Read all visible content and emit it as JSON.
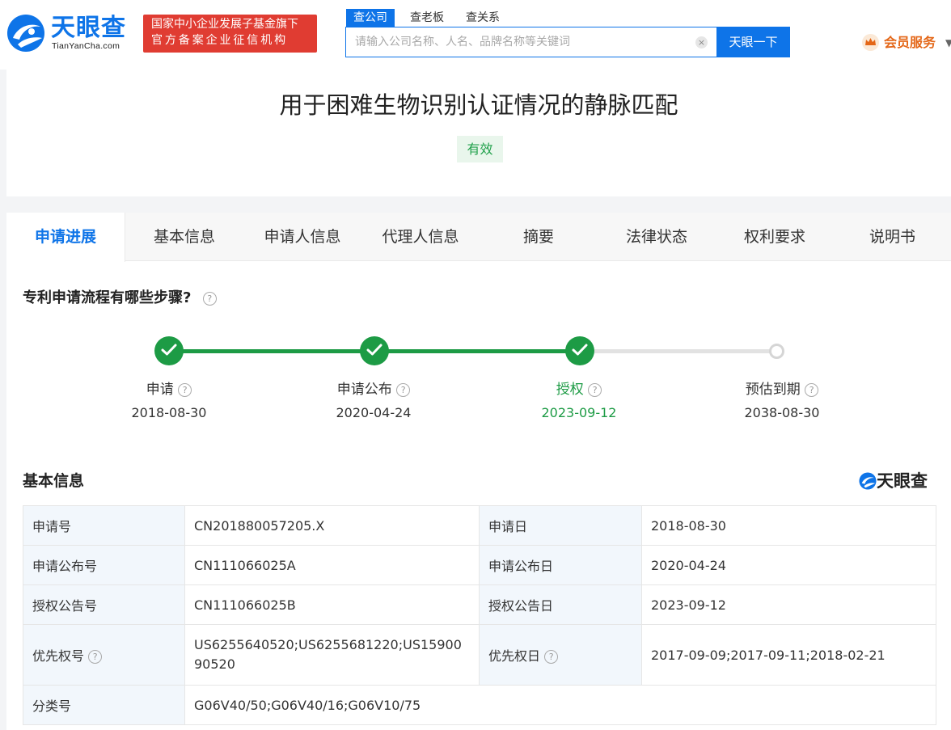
{
  "header": {
    "logo_name": "天眼查",
    "logo_domain": "TianYanCha.com",
    "badge_line1": "国家中小企业发展子基金旗下",
    "badge_line2": "官方备案企业征信机构",
    "search_tabs": [
      "查公司",
      "查老板",
      "查关系"
    ],
    "search_placeholder": "请输入公司名称、人名、品牌名称等关键词",
    "search_button": "天眼一下",
    "member_label": "会员服务"
  },
  "patent": {
    "title": "用于困难生物识别认证情况的静脉匹配",
    "status": "有效"
  },
  "tabs": [
    "申请进展",
    "基本信息",
    "申请人信息",
    "代理人信息",
    "摘要",
    "法律状态",
    "权利要求",
    "说明书"
  ],
  "progress": {
    "question": "专利申请流程有哪些步骤?",
    "steps": [
      {
        "label": "申请",
        "date": "2018-08-30",
        "state": "done"
      },
      {
        "label": "申请公布",
        "date": "2020-04-24",
        "state": "done"
      },
      {
        "label": "授权",
        "date": "2023-09-12",
        "state": "current"
      },
      {
        "label": "预估到期",
        "date": "2038-08-30",
        "state": "pending"
      }
    ]
  },
  "basic_info": {
    "title": "基本信息",
    "watermark": "天眼查",
    "rows": [
      {
        "k1": "申请号",
        "v1": "CN201880057205.X",
        "k2": "申请日",
        "v2": "2018-08-30"
      },
      {
        "k1": "申请公布号",
        "v1": "CN111066025A",
        "k2": "申请公布日",
        "v2": "2020-04-24"
      },
      {
        "k1": "授权公告号",
        "v1": "CN111066025B",
        "k2": "授权公告日",
        "v2": "2023-09-12"
      },
      {
        "k1": "优先权号",
        "v1": "US6255640520;US6255681220;US1590090520",
        "k2": "优先权日",
        "v2": "2017-09-09;2017-09-11;2018-02-21"
      },
      {
        "k1": "分类号",
        "v1": "G06V40/50;G06V40/16;G06V10/75"
      }
    ]
  },
  "colors": {
    "brand_blue": "#0e74e8",
    "success_green": "#1d9b45",
    "badge_red": "#e03c32",
    "member_orange": "#e46718"
  }
}
